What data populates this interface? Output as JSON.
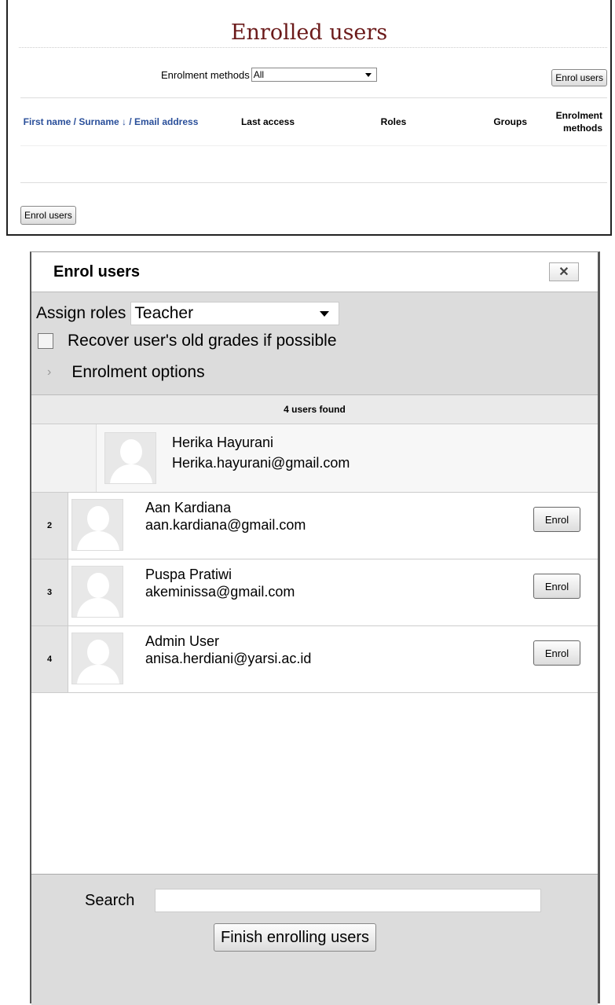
{
  "enrolled_panel": {
    "title": "Enrolled users",
    "methods_label": "Enrolment methods",
    "methods_value": "All",
    "enrol_users_button": "Enrol users",
    "columns": {
      "name": "First name / Surname ↓ / Email address",
      "last_access": "Last access",
      "roles": "Roles",
      "groups": "Groups",
      "methods": "Enrolment methods"
    }
  },
  "dialog": {
    "title": "Enrol users",
    "close_glyph": "✕",
    "assign_roles_label": "Assign roles",
    "assign_roles_value": "Teacher",
    "recover_label": "Recover user's old grades if possible",
    "options_label": "Enrolment options",
    "users_found": "4 users found",
    "first_user": {
      "name": "Herika Hayurani",
      "email": "Herika.hayurani@gmail.com"
    },
    "users": [
      {
        "num": "2",
        "name": "Aan Kardiana",
        "email": "aan.kardiana@gmail.com",
        "button": "Enrol"
      },
      {
        "num": "3",
        "name": "Puspa Pratiwi",
        "email": "akeminissa@gmail.com",
        "button": "Enrol"
      },
      {
        "num": "4",
        "name": "Admin User",
        "email": "anisa.herdiani@yarsi.ac.id",
        "button": "Enrol"
      }
    ],
    "search_label": "Search",
    "search_value": "",
    "finish_button": "Finish enrolling users"
  },
  "icons": {
    "sort": "arrow-down-icon",
    "close": "close-icon",
    "expand": "chevron-right-icon",
    "dropdown": "caret-down-icon",
    "avatar": "user-avatar-icon"
  }
}
